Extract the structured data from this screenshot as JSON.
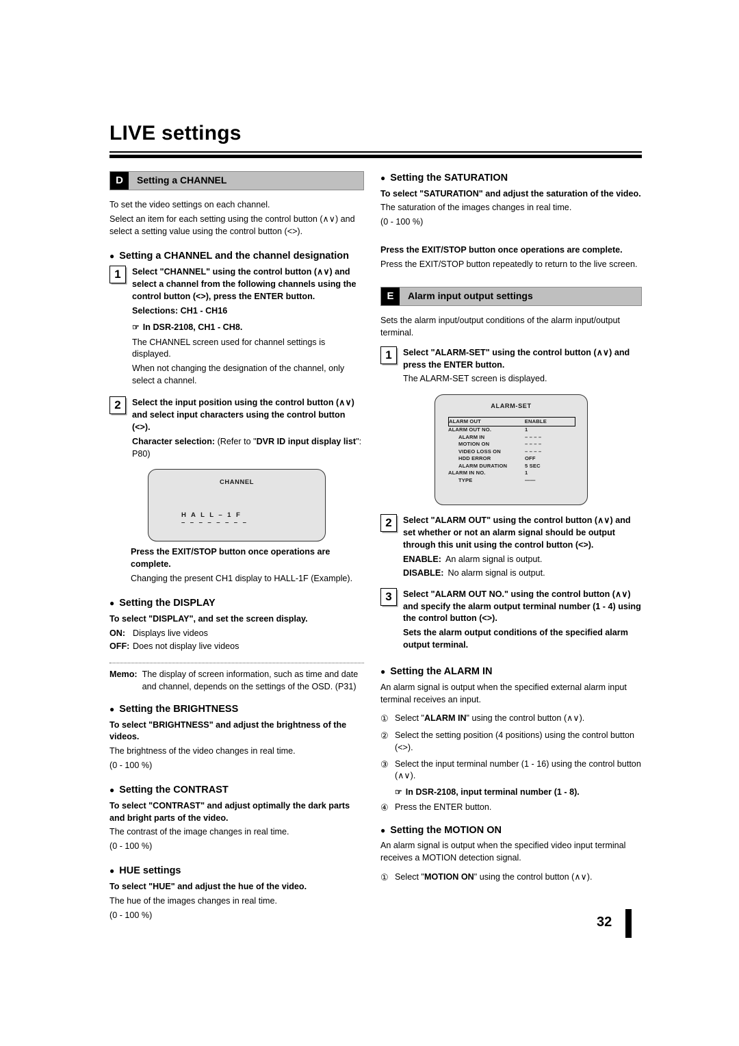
{
  "document": {
    "title": "LIVE settings",
    "page_number": "32"
  },
  "left_column": {
    "section_d": {
      "letter": "D",
      "label": "Setting a CHANNEL",
      "intro_1": "To set the video settings on each channel.",
      "intro_2": "Select an item for each setting using the control button (∧∨) and select a setting value using the control button (<>)."
    },
    "channel_designation": {
      "heading": "Setting a CHANNEL and the channel designation",
      "step1": {
        "num": "1",
        "bold_text": "Select \"CHANNEL\" using the control button (∧∨) and select a channel from the following channels using the control button (<>), press the ENTER button.",
        "selections": "Selections: CH1 - CH16",
        "pointer_note": "In DSR-2108, CH1 - CH8.",
        "body_1": "The CHANNEL screen used for channel settings is displayed.",
        "body_2": "When not changing the designation of the channel, only select a channel."
      },
      "step2": {
        "num": "2",
        "bold_text": "Select the input position using the control button (∧∨) and select input characters using the control button (<>).",
        "char_selection_bold": "Character selection:",
        "char_selection_rest_a": " (Refer to \"",
        "char_selection_ref": "DVR ID input display list",
        "char_selection_rest_b": "\": P80)"
      },
      "osd_channel": {
        "title": "CHANNEL",
        "value": "H A L L – 1 F",
        "underline": "– – – – – – – –"
      },
      "exit_bold": "Press the EXIT/STOP button once operations are complete.",
      "exit_body": "Changing the present CH1 display to HALL-1F (Example)."
    },
    "display": {
      "heading": "Setting the DISPLAY",
      "lead": "To select \"DISPLAY\", and set the screen display.",
      "options": [
        {
          "key": "ON:",
          "value": "Displays live videos"
        },
        {
          "key": "OFF:",
          "value": "Does not display live videos"
        }
      ]
    },
    "memo": {
      "label": "Memo:",
      "text": "The display of screen information, such as time and date and channel, depends on the settings of the OSD. (P31)"
    },
    "brightness": {
      "heading": "Setting the BRIGHTNESS",
      "lead": "To select \"BRIGHTNESS\" and adjust the brightness of the videos.",
      "body": "The brightness of the video changes in real time.",
      "range": "(0 - 100 %)"
    },
    "contrast": {
      "heading": "Setting the CONTRAST",
      "lead": "To select \"CONTRAST\" and adjust optimally the dark parts and bright parts of the video.",
      "body": "The contrast of the image changes in real time.",
      "range": "(0 - 100 %)"
    },
    "hue": {
      "heading": "HUE settings",
      "lead": "To select \"HUE\" and adjust the hue of the video.",
      "body": "The hue of the images changes in real time.",
      "range": "(0 - 100 %)"
    }
  },
  "right_column": {
    "saturation": {
      "heading": "Setting the SATURATION",
      "lead": "To select \"SATURATION\" and adjust the saturation of the video.",
      "body": "The saturation of the images changes in real time.",
      "range": "(0 - 100 %)"
    },
    "exit_note": {
      "bold": "Press the EXIT/STOP button once operations are complete.",
      "body": "Press the EXIT/STOP button repeatedly to return to the live screen."
    },
    "section_e": {
      "letter": "E",
      "label": "Alarm input output settings",
      "intro": "Sets the alarm input/output conditions of the alarm input/output terminal.",
      "step1": {
        "num": "1",
        "bold_text": "Select \"ALARM-SET\" using the control button (∧∨) and press the ENTER button.",
        "body": "The ALARM-SET screen is displayed."
      },
      "step2": {
        "num": "2",
        "bold_text": "Select \"ALARM OUT\" using the control button (∧∨) and set whether or not an alarm signal should be output through this unit using the control button (<>).",
        "options": [
          {
            "key": "ENABLE:",
            "value": "An alarm signal is output."
          },
          {
            "key": "DISABLE:",
            "value": "No alarm signal is output."
          }
        ]
      },
      "step3": {
        "num": "3",
        "bold_text": "Select \"ALARM OUT NO.\" using the control button (∧∨) and specify the alarm output terminal number (1 - 4) using the control button (<>).",
        "bold_text_2": "Sets the alarm output conditions of the specified alarm output terminal."
      }
    },
    "osd_alarm": {
      "title": "ALARM-SET",
      "rows": [
        {
          "name": "ALARM OUT",
          "value": "ENABLE",
          "indent": 0,
          "highlight": true
        },
        {
          "name": "ALARM OUT NO.",
          "value": "1",
          "indent": 0,
          "highlight": false
        },
        {
          "name": "ALARM IN",
          "value": "– – – –",
          "indent": 1,
          "highlight": false
        },
        {
          "name": "MOTION ON",
          "value": "– – – –",
          "indent": 1,
          "highlight": false
        },
        {
          "name": "VIDEO LOSS ON",
          "value": "– – – –",
          "indent": 1,
          "highlight": false
        },
        {
          "name": "HDD ERROR",
          "value": "OFF",
          "indent": 1,
          "highlight": false
        },
        {
          "name": "ALARM DURATION",
          "value": "5 SEC",
          "indent": 1,
          "highlight": false
        },
        {
          "name": "ALARM IN NO.",
          "value": "1",
          "indent": 0,
          "highlight": false
        },
        {
          "name": "TYPE",
          "value": "——",
          "indent": 1,
          "highlight": false
        }
      ]
    },
    "alarm_in": {
      "heading": "Setting the ALARM IN",
      "lead": "An alarm signal is output when the specified external alarm input terminal receives an input.",
      "items": [
        {
          "num": "①",
          "pre": "Select \"",
          "bold": "ALARM IN",
          "post": "\" using the control button (∧∨)."
        },
        {
          "num": "②",
          "pre": "Select the setting position (4 positions) using the control button (<>).",
          "bold": "",
          "post": ""
        },
        {
          "num": "③",
          "pre": "Select the input terminal number (1 - 16) using the control button (∧∨).",
          "bold": "",
          "post": ""
        },
        {
          "num": "④",
          "pre": "Press the ENTER button.",
          "bold": "",
          "post": ""
        }
      ],
      "pointer_note": "In DSR-2108, input terminal number (1 - 8)."
    },
    "motion_on": {
      "heading": "Setting the MOTION ON",
      "lead": "An alarm signal is output when the specified video input terminal receives a MOTION detection signal.",
      "item1": {
        "num": "①",
        "pre": "Select \"",
        "bold": "MOTION ON",
        "post": "\" using the control button (∧∨)."
      }
    }
  }
}
